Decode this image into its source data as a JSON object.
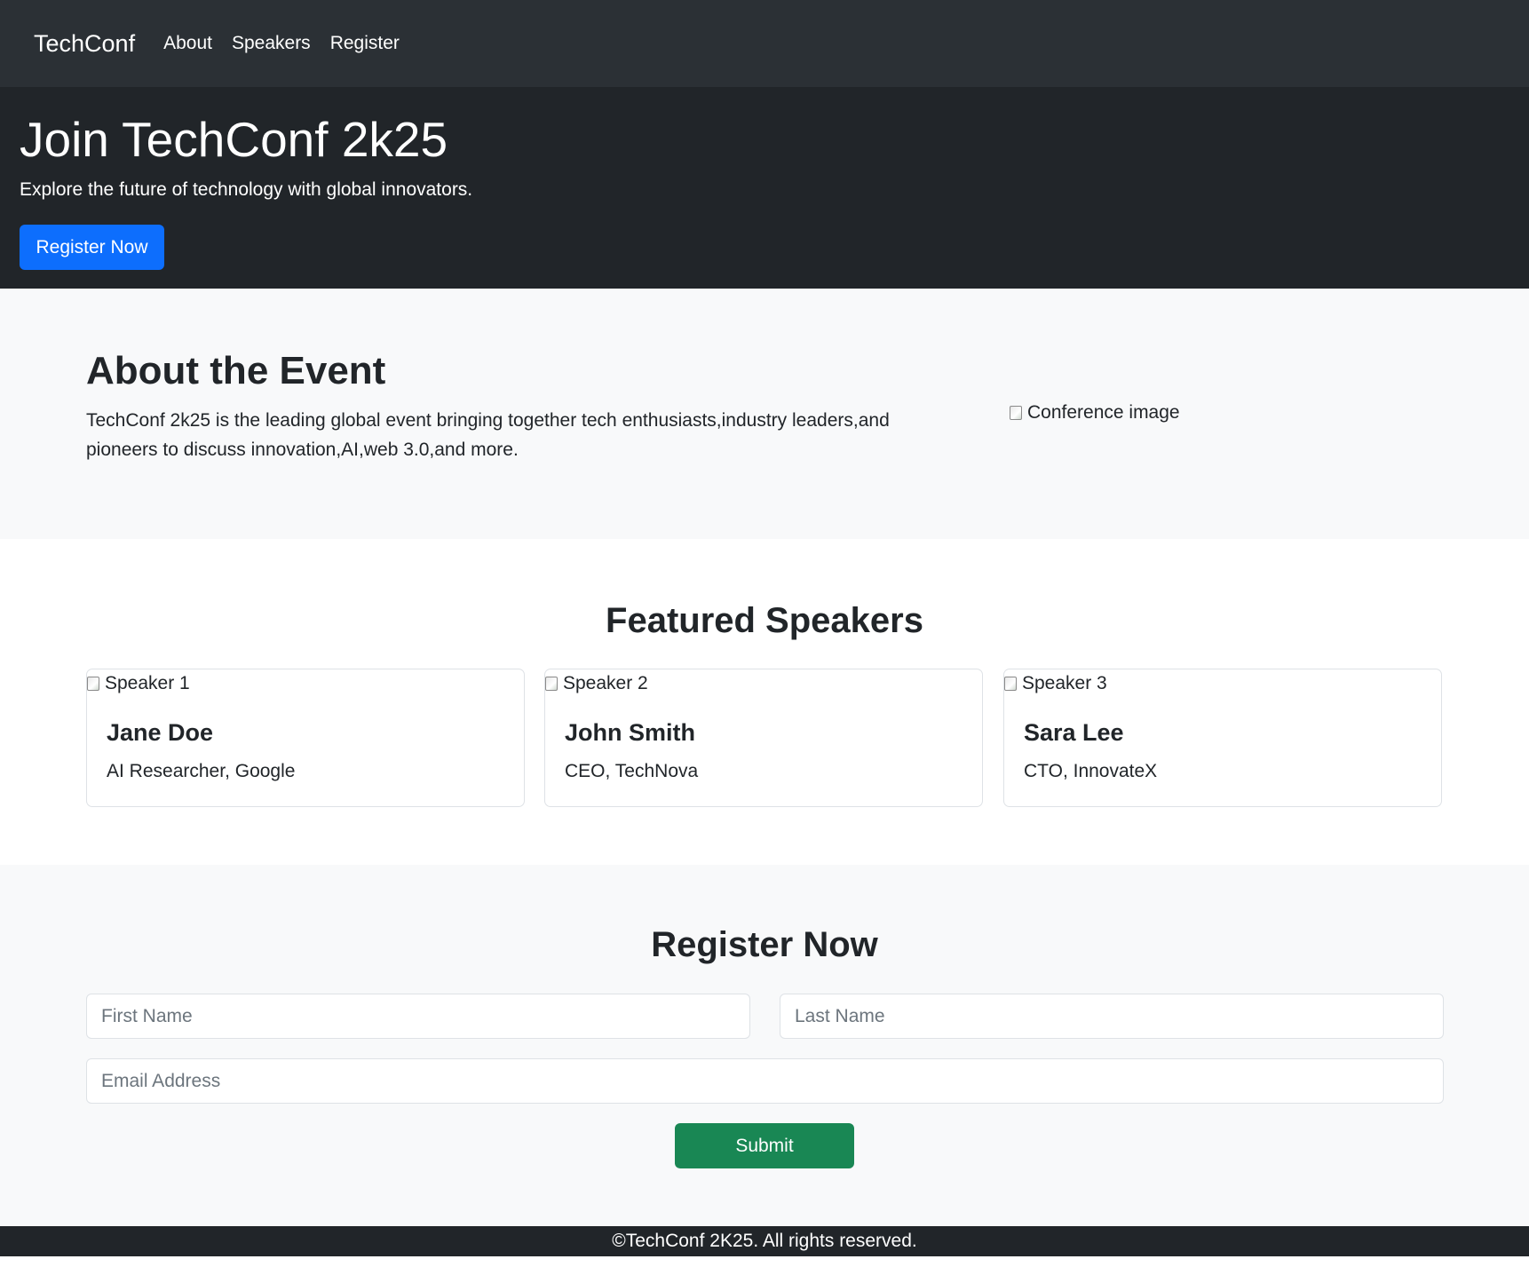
{
  "navbar": {
    "brand": "TechConf",
    "links": [
      {
        "label": "About"
      },
      {
        "label": "Speakers"
      },
      {
        "label": "Register"
      }
    ]
  },
  "hero": {
    "title": "Join TechConf 2k25",
    "subtitle": "Explore the future of technology with global innovators.",
    "button_label": "Register Now"
  },
  "about": {
    "title": "About the Event",
    "text": "TechConf 2k25 is the leading global event bringing together tech enthusiasts,industry leaders,and pioneers to discuss innovation,AI,web 3.0,and more.",
    "image_alt": "Conference image"
  },
  "speakers": {
    "title": "Featured Speakers",
    "items": [
      {
        "image_alt": "Speaker 1",
        "name": "Jane Doe",
        "role": "AI Researcher, Google"
      },
      {
        "image_alt": "Speaker 2",
        "name": "John Smith",
        "role": "CEO, TechNova"
      },
      {
        "image_alt": "Speaker 3",
        "name": "Sara Lee",
        "role": "CTO, InnovateX"
      }
    ]
  },
  "register": {
    "title": "Register Now",
    "first_name_placeholder": "First Name",
    "last_name_placeholder": "Last Name",
    "email_placeholder": "Email Address",
    "submit_label": "Submit"
  },
  "footer": {
    "text": "©TechConf 2K25. All rights reserved."
  },
  "colors": {
    "navbar_bg": "#2b3035",
    "hero_bg": "#212529",
    "primary": "#0d6efd",
    "success": "#198754",
    "section_light": "#f8f9fa"
  }
}
